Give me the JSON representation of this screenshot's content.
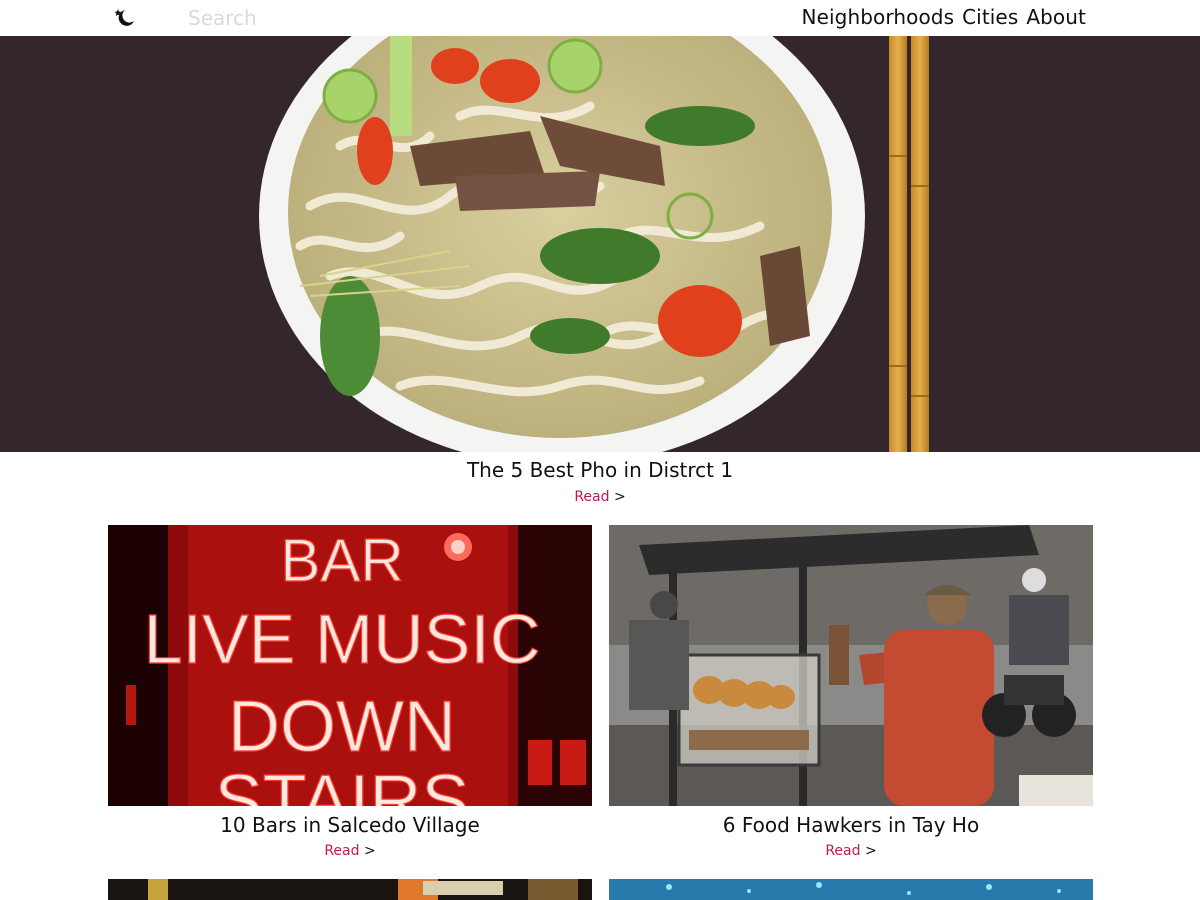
{
  "header": {
    "logo_icon": "moon-star-icon",
    "search_placeholder": "Search",
    "nav": [
      "Neighborhoods",
      "Cities",
      "About"
    ]
  },
  "hero": {
    "image": "pho-bowl-photo",
    "title": "The 5 Best Pho in Distrct 1",
    "read_label": "Read",
    "read_arrow": ">"
  },
  "cards": [
    {
      "image": "neon-bar-sign-photo",
      "image_text": [
        "BAR",
        "LIVE MUSIC",
        "DOWN",
        "STAIRS"
      ],
      "title": "10 Bars in Salcedo Village",
      "read_label": "Read",
      "read_arrow": ">"
    },
    {
      "image": "street-food-hawker-photo",
      "title": "6 Food Hawkers in Tay Ho",
      "read_label": "Read",
      "read_arrow": ">"
    }
  ],
  "colors": {
    "accent": "#c2185b",
    "placeholder": "#d9d9d9",
    "text": "#111111"
  }
}
